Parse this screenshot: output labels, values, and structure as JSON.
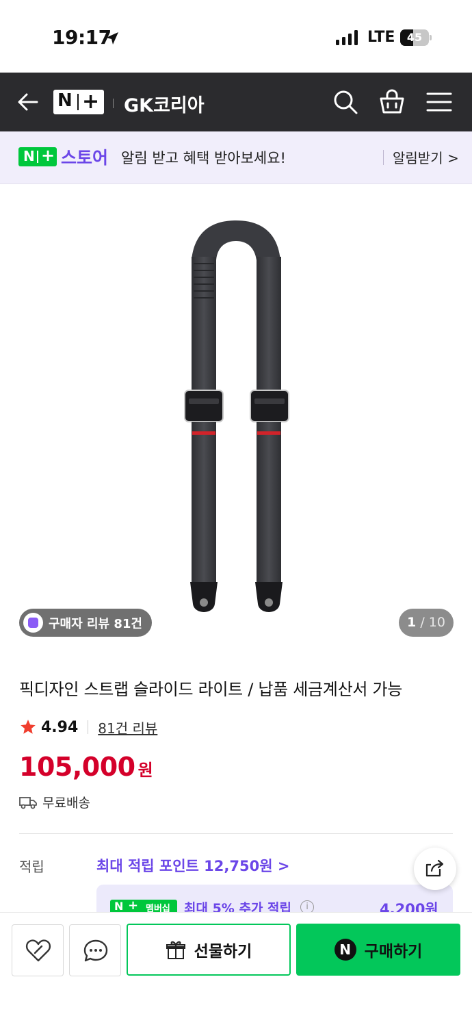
{
  "status_bar": {
    "time": "19:17",
    "network": "LTE",
    "battery_level": "45",
    "battery_fraction": 0.45
  },
  "header": {
    "logo_n": "N",
    "logo_plus": "+",
    "store_name": "GK코리아",
    "icons": [
      "back-arrow-icon",
      "search-icon",
      "cart-icon",
      "menu-icon"
    ]
  },
  "banner": {
    "logo_n": "N",
    "logo_plus": "+",
    "store_label": "스토어",
    "message": "알림 받고 혜택 받아보세요!",
    "cta": "알림받기 >"
  },
  "gallery": {
    "review_badge": "구매자 리뷰 81건",
    "counter_current": "1",
    "counter_total": " / 10"
  },
  "product": {
    "title": "픽디자인 스트랩 슬라이드 라이트 / 납품 세금계산서 가능",
    "rating": "4.94",
    "review_link": "81건 리뷰",
    "price": "105,000",
    "price_unit": "원",
    "shipping": "무료배송"
  },
  "points": {
    "label": "적립",
    "link": "최대 적립 포인트 12,750원 >",
    "membership_badge": "멤버십",
    "membership_badge_n": "N",
    "membership_badge_plus": "+",
    "membership_text": "최대 5% 추가 적립",
    "membership_info": "i",
    "membership_amount": "4,200원"
  },
  "bottom_bar": {
    "gift_label": "선물하기",
    "buy_n": "N",
    "buy_label": "구매하기"
  },
  "colors": {
    "header_bg": "#2b2b2e",
    "naver_green": "#03c75a",
    "accent_purple": "#6b46e8",
    "price_red": "#d4002a",
    "banner_bg": "#f1eefb"
  }
}
